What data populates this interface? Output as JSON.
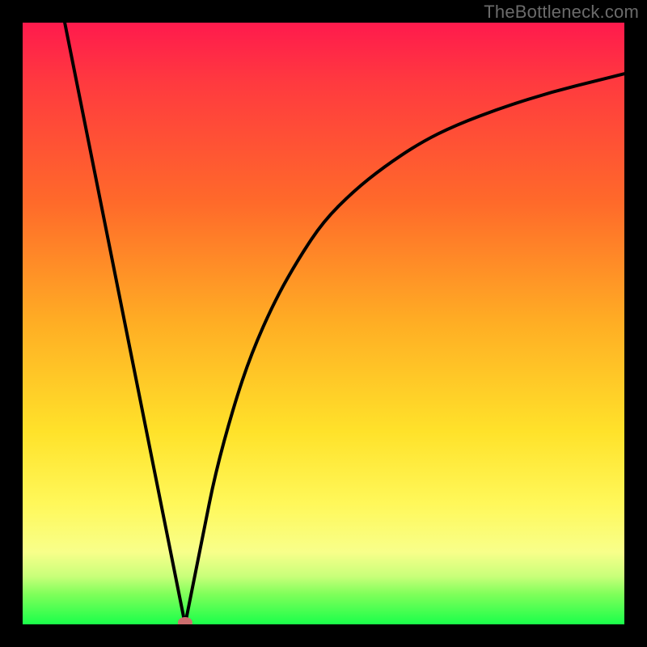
{
  "attribution": "TheBottleneck.com",
  "chart_data": {
    "type": "line",
    "title": "",
    "xlabel": "",
    "ylabel": "",
    "xlim": [
      0,
      100
    ],
    "ylim": [
      0,
      100
    ],
    "series": [
      {
        "name": "left-branch",
        "x": [
          7,
          8,
          10,
          12,
          14,
          16,
          18,
          20,
          22,
          24,
          26,
          27
        ],
        "y": [
          100,
          95,
          85,
          75,
          65,
          55,
          45,
          35,
          25,
          15,
          5,
          0
        ]
      },
      {
        "name": "right-branch",
        "x": [
          27,
          28,
          30,
          32,
          35,
          38,
          42,
          46,
          50,
          55,
          60,
          66,
          72,
          80,
          88,
          96,
          100
        ],
        "y": [
          0,
          5,
          15,
          25,
          36,
          45,
          54,
          61,
          67,
          72,
          76,
          80,
          83,
          86,
          88.5,
          90.5,
          91.5
        ]
      }
    ],
    "marker": {
      "x": 27,
      "y": 0,
      "color": "#cc6e6e"
    },
    "gradient_stops": [
      {
        "pct": 0,
        "color": "#ff1a4d"
      },
      {
        "pct": 50,
        "color": "#ffae24"
      },
      {
        "pct": 80,
        "color": "#fff85a"
      },
      {
        "pct": 100,
        "color": "#1aff4a"
      }
    ],
    "notes": "Black frame ~28px. No axis ticks or labels visible. Single black curve forming a V with curved right arm. Small muted-red dot at the minimum."
  }
}
